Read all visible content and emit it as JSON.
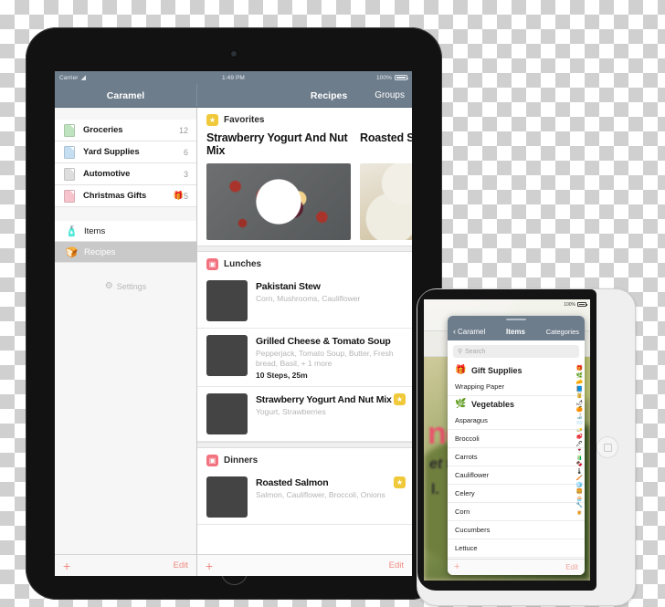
{
  "ipad": {
    "status_bar": {
      "carrier": "Carrier",
      "wifi_icon": "wifi-icon",
      "time": "1:49 PM",
      "battery_percent": "100%"
    },
    "nav_bar": {
      "left_title": "Caramel",
      "right_title": "Recipes",
      "right_action": "Groups"
    },
    "sidebar": {
      "lists": [
        {
          "label": "Groceries",
          "count": "12",
          "color": "#bfe3bf",
          "emoji": ""
        },
        {
          "label": "Yard Supplies",
          "count": "6",
          "color": "#c5def2",
          "emoji": ""
        },
        {
          "label": "Automotive",
          "count": "3",
          "color": "#dedede",
          "emoji": ""
        },
        {
          "label": "Christmas Gifts",
          "count": "5",
          "color": "#f7c3cc",
          "emoji": "🎁"
        }
      ],
      "nav_items": [
        {
          "label": "Items",
          "icon": "bottle-icon",
          "glyph": "🧴",
          "selected": false
        },
        {
          "label": "Recipes",
          "icon": "recipe-icon",
          "glyph": "🍞",
          "selected": true
        }
      ],
      "settings_label": "Settings",
      "settings_icon": "gear-icon",
      "toolbar": {
        "add_label": "+",
        "edit_label": "Edit"
      }
    },
    "detail": {
      "sections": [
        {
          "title": "Favorites",
          "icon": "star-badge-icon",
          "icon_glyph": "★",
          "icon_color": "#f0c93a",
          "type": "carousel",
          "cards": [
            {
              "name": "Strawberry Yogurt And Nut Mix",
              "photo": "photo-yogurt"
            },
            {
              "name": "Roasted Salmon",
              "photo": "photo-salmon"
            }
          ]
        },
        {
          "title": "Lunches",
          "icon": "lunch-bag-icon",
          "icon_glyph": "▣",
          "icon_color": "#f2737f",
          "type": "list",
          "recipes": [
            {
              "name": "Pakistani Stew",
              "ingredients": "Corn, Mushrooms, Cauliflower",
              "steps": "",
              "favorite": false,
              "photo": "photo-stew"
            },
            {
              "name": "Grilled Cheese & Tomato Soup",
              "ingredients": "Pepperjack, Tomato Soup, Butter, Fresh bread, Basil,  + 1 more",
              "steps": "10 Steps, 25m",
              "favorite": false,
              "photo": "photo-grilled"
            },
            {
              "name": "Strawberry Yogurt And Nut Mix",
              "ingredients": "Yogurt, Strawberries",
              "steps": "",
              "favorite": true,
              "photo": "photo-yogurt"
            }
          ]
        },
        {
          "title": "Dinners",
          "icon": "dinner-bag-icon",
          "icon_glyph": "▣",
          "icon_color": "#f2737f",
          "type": "list",
          "recipes": [
            {
              "name": "Roasted Salmon",
              "ingredients": "Salmon, Cauliflower, Broccoli, Onions",
              "steps": "",
              "favorite": true,
              "photo": "photo-salmon-row"
            }
          ]
        }
      ],
      "toolbar": {
        "add_label": "+",
        "edit_label": "Edit"
      }
    }
  },
  "ipad_mini": {
    "status_bar": {
      "battery_percent": "100%"
    },
    "background_text": {
      "line1": "ne",
      "line2": "et t",
      "line3": "l."
    },
    "popover": {
      "nav": {
        "back_label": "Caramel",
        "back_icon": "chevron-left-icon",
        "title": "Items",
        "action": "Categories"
      },
      "search": {
        "placeholder": "Search",
        "icon": "search-icon"
      },
      "categories": [
        {
          "name": "Gift Supplies",
          "icon": "gift-icon",
          "glyph": "🎁",
          "items": [
            "Wrapping Paper"
          ]
        },
        {
          "name": "Vegetables",
          "icon": "vegetable-icon",
          "glyph": "🌿",
          "items": [
            "Asparagus",
            "Broccoli",
            "Carrots",
            "Cauliflower",
            "Celery",
            "Corn",
            "Cucumbers",
            "Lettuce"
          ]
        }
      ],
      "index_icons": [
        "🎁",
        "🌿",
        "🧀",
        "📘",
        "🥫",
        "🌶",
        "🍊",
        "🍶",
        "📨",
        "🧈",
        "🥩",
        "🖊",
        "🍷",
        "🧃",
        "🍫",
        "🌡",
        "🪥",
        "🧊",
        "🍔",
        "🧁",
        "🔧",
        "🍺"
      ],
      "toolbar": {
        "add_label": "+",
        "edit_label": "Edit"
      }
    },
    "home_button": "home-button"
  }
}
